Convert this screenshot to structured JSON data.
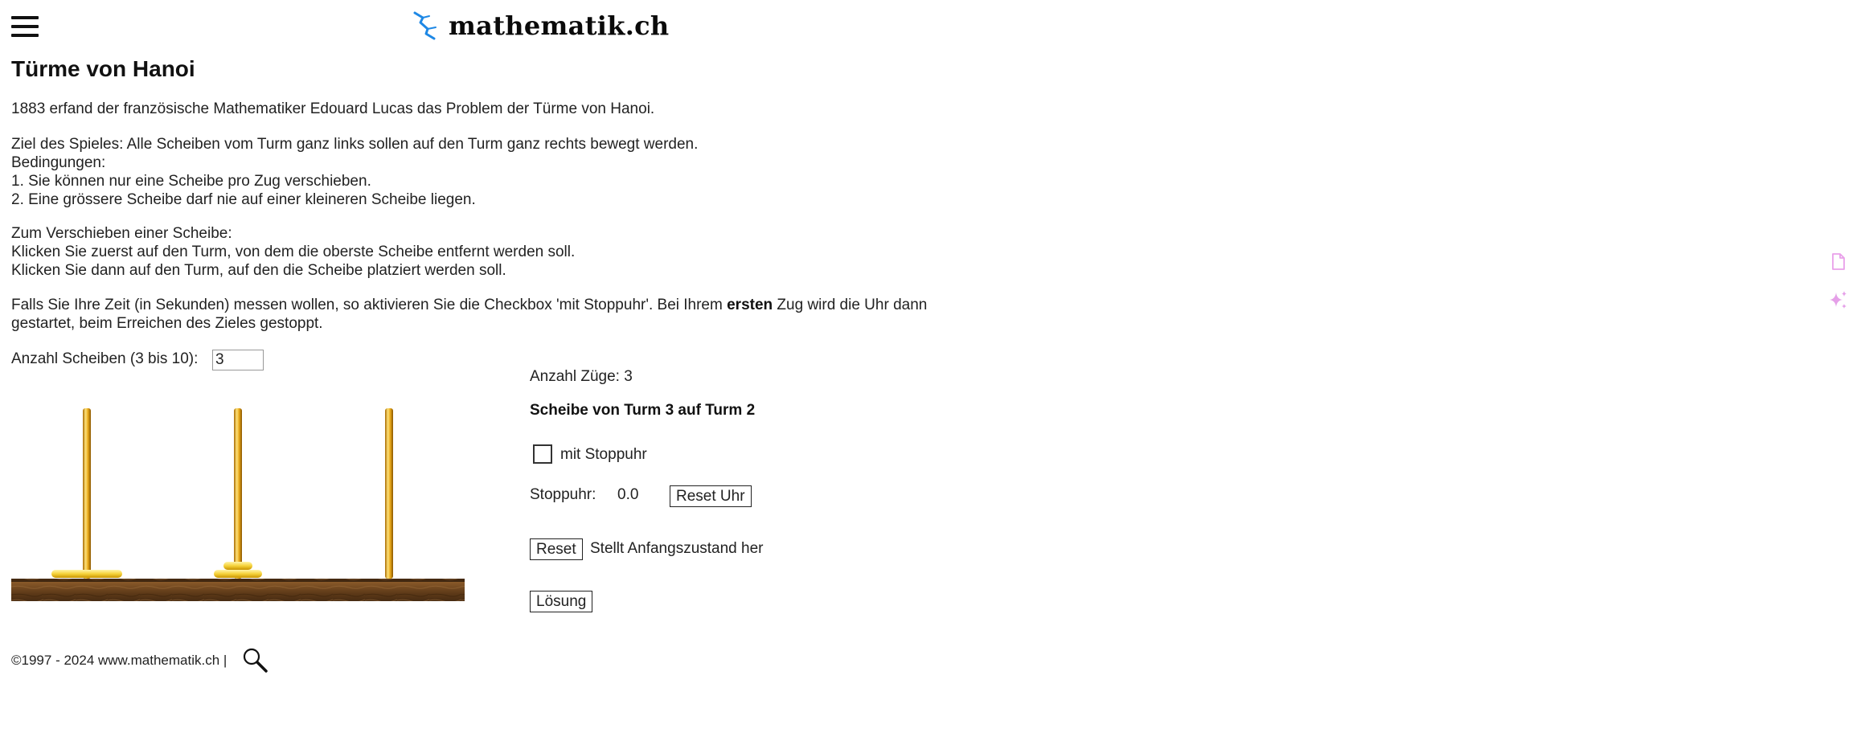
{
  "header": {
    "menu_icon": "hamburger-menu-icon",
    "logo_icon": "lightning-icon",
    "logo_text": "mathematik.ch"
  },
  "title": "Türme von Hanoi",
  "intro": "1883 erfand der französische Mathematiker Edouard Lucas das Problem der Türme von Hanoi.",
  "goal_lines": [
    "Ziel des Spieles: Alle Scheiben vom Turm ganz links sollen auf den Turm ganz rechts bewegt werden.",
    "Bedingungen:",
    "1. Sie können nur eine Scheibe pro Zug verschieben.",
    "2. Eine grössere Scheibe darf nie auf einer kleineren Scheibe liegen."
  ],
  "move_lines": [
    "Zum Verschieben einer Scheibe:",
    "Klicken Sie zuerst auf den Turm, von dem die oberste Scheibe entfernt werden soll.",
    "Klicken Sie dann auf den Turm, auf den die Scheibe platziert werden soll."
  ],
  "timer_text": {
    "before": "Falls Sie Ihre Zeit (in Sekunden) messen wollen, so aktivieren Sie die Checkbox 'mit Stoppuhr'. Bei Ihrem ",
    "bold": "ersten",
    "after_line1": " Zug wird die Uhr dann",
    "line2": "gestartet, beim Erreichen des Zieles gestoppt."
  },
  "discs": {
    "label": "Anzahl Scheiben (3 bis 10):",
    "value": "3"
  },
  "game": {
    "tower_count": 3,
    "discs_per_tower": [
      1,
      2,
      0
    ],
    "moves_label": "Anzahl Züge: 3",
    "instruction": "Scheibe von Turm 3 auf Turm 2",
    "colors": {
      "rod": "#e8b020",
      "disc": "#f4d040",
      "base": "#6b4420"
    }
  },
  "stopwatch": {
    "checkbox_label": "mit Stoppuhr",
    "checked": false,
    "label": "Stoppuhr:",
    "value": "0.0",
    "reset_clock_label": "Reset Uhr"
  },
  "controls": {
    "reset_label": "Reset",
    "reset_desc": "Stellt Anfangszustand her",
    "solution_label": "Lösung"
  },
  "footer": {
    "text": "©1997 - 2024 www.mathematik.ch |",
    "search_icon": "magnifier-icon"
  },
  "side_icons": [
    "document-icon",
    "sparkle-icon"
  ]
}
